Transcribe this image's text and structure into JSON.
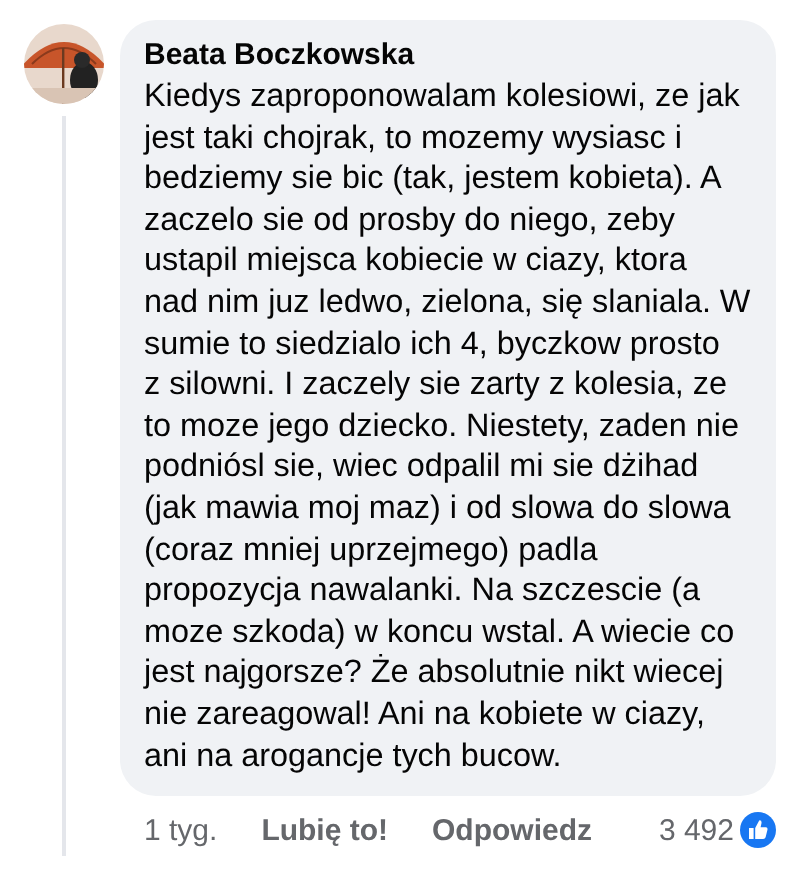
{
  "comment": {
    "author": "Beata Boczkowska",
    "text": "Kiedys zaproponowalam kolesiowi, ze jak\njest taki chojrak, to mozemy wysiasc i\nbedziemy sie bic (tak, jestem kobieta). A\nzaczelo sie od prosby do niego, zeby\nustapil miejsca kobiecie w ciazy, ktora\nnad nim juz ledwo, zielona, się slaniala. W\nsumie to siedzialo ich 4, byczkow prosto\nz silowni. I zaczely sie zarty z kolesia, ze\nto moze jego dziecko. Niestety, zaden nie\npodniósl sie, wiec odpalil mi sie dżihad\n(jak mawia moj maz) i od slowa do slowa\n(coraz mniej uprzejmego) padla\npropozycja nawalanki. Na szczescie (a\nmoze szkoda) w koncu wstal. A wiecie co\njest najgorsze? Że absolutnie nikt wiecej\nnie zareagowal! Ani na kobiete w ciazy,\nani na arogancje tych bucow.",
    "time": "1 tyg.",
    "like": "Lubię to!",
    "reply": "Odpowiedz",
    "reactions": "3 492"
  }
}
